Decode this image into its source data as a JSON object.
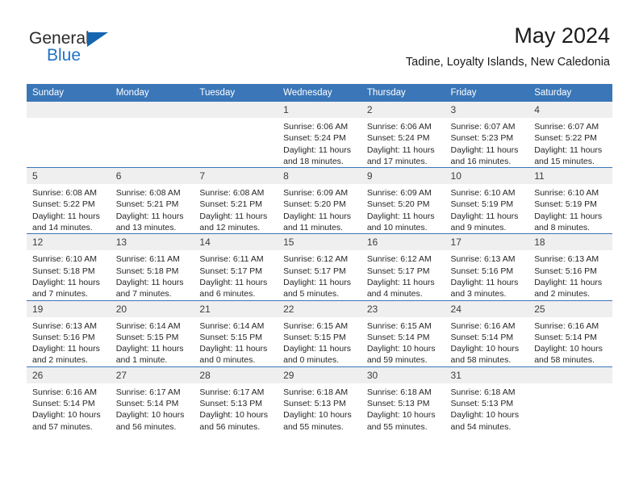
{
  "brand": {
    "name_part1": "General",
    "name_part2": "Blue",
    "accent_color": "#1f73c4",
    "triangle_color": "#1565b0",
    "logo_icon": "triangle-flag-icon"
  },
  "header": {
    "title": "May 2024",
    "subtitle": "Tadine, Loyalty Islands, New Caledonia"
  },
  "theme": {
    "header_bg": "#3a76b8",
    "daynum_bg": "#efefef",
    "cell_border": "#3a76b8"
  },
  "calendar": {
    "weekday_headers": [
      "Sunday",
      "Monday",
      "Tuesday",
      "Wednesday",
      "Thursday",
      "Friday",
      "Saturday"
    ],
    "weeks": [
      [
        {
          "day": "",
          "sunrise": "",
          "sunset": "",
          "daylight_line1": "",
          "daylight_line2": ""
        },
        {
          "day": "",
          "sunrise": "",
          "sunset": "",
          "daylight_line1": "",
          "daylight_line2": ""
        },
        {
          "day": "",
          "sunrise": "",
          "sunset": "",
          "daylight_line1": "",
          "daylight_line2": ""
        },
        {
          "day": "1",
          "sunrise": "Sunrise: 6:06 AM",
          "sunset": "Sunset: 5:24 PM",
          "daylight_line1": "Daylight: 11 hours",
          "daylight_line2": "and 18 minutes."
        },
        {
          "day": "2",
          "sunrise": "Sunrise: 6:06 AM",
          "sunset": "Sunset: 5:24 PM",
          "daylight_line1": "Daylight: 11 hours",
          "daylight_line2": "and 17 minutes."
        },
        {
          "day": "3",
          "sunrise": "Sunrise: 6:07 AM",
          "sunset": "Sunset: 5:23 PM",
          "daylight_line1": "Daylight: 11 hours",
          "daylight_line2": "and 16 minutes."
        },
        {
          "day": "4",
          "sunrise": "Sunrise: 6:07 AM",
          "sunset": "Sunset: 5:22 PM",
          "daylight_line1": "Daylight: 11 hours",
          "daylight_line2": "and 15 minutes."
        }
      ],
      [
        {
          "day": "5",
          "sunrise": "Sunrise: 6:08 AM",
          "sunset": "Sunset: 5:22 PM",
          "daylight_line1": "Daylight: 11 hours",
          "daylight_line2": "and 14 minutes."
        },
        {
          "day": "6",
          "sunrise": "Sunrise: 6:08 AM",
          "sunset": "Sunset: 5:21 PM",
          "daylight_line1": "Daylight: 11 hours",
          "daylight_line2": "and 13 minutes."
        },
        {
          "day": "7",
          "sunrise": "Sunrise: 6:08 AM",
          "sunset": "Sunset: 5:21 PM",
          "daylight_line1": "Daylight: 11 hours",
          "daylight_line2": "and 12 minutes."
        },
        {
          "day": "8",
          "sunrise": "Sunrise: 6:09 AM",
          "sunset": "Sunset: 5:20 PM",
          "daylight_line1": "Daylight: 11 hours",
          "daylight_line2": "and 11 minutes."
        },
        {
          "day": "9",
          "sunrise": "Sunrise: 6:09 AM",
          "sunset": "Sunset: 5:20 PM",
          "daylight_line1": "Daylight: 11 hours",
          "daylight_line2": "and 10 minutes."
        },
        {
          "day": "10",
          "sunrise": "Sunrise: 6:10 AM",
          "sunset": "Sunset: 5:19 PM",
          "daylight_line1": "Daylight: 11 hours",
          "daylight_line2": "and 9 minutes."
        },
        {
          "day": "11",
          "sunrise": "Sunrise: 6:10 AM",
          "sunset": "Sunset: 5:19 PM",
          "daylight_line1": "Daylight: 11 hours",
          "daylight_line2": "and 8 minutes."
        }
      ],
      [
        {
          "day": "12",
          "sunrise": "Sunrise: 6:10 AM",
          "sunset": "Sunset: 5:18 PM",
          "daylight_line1": "Daylight: 11 hours",
          "daylight_line2": "and 7 minutes."
        },
        {
          "day": "13",
          "sunrise": "Sunrise: 6:11 AM",
          "sunset": "Sunset: 5:18 PM",
          "daylight_line1": "Daylight: 11 hours",
          "daylight_line2": "and 7 minutes."
        },
        {
          "day": "14",
          "sunrise": "Sunrise: 6:11 AM",
          "sunset": "Sunset: 5:17 PM",
          "daylight_line1": "Daylight: 11 hours",
          "daylight_line2": "and 6 minutes."
        },
        {
          "day": "15",
          "sunrise": "Sunrise: 6:12 AM",
          "sunset": "Sunset: 5:17 PM",
          "daylight_line1": "Daylight: 11 hours",
          "daylight_line2": "and 5 minutes."
        },
        {
          "day": "16",
          "sunrise": "Sunrise: 6:12 AM",
          "sunset": "Sunset: 5:17 PM",
          "daylight_line1": "Daylight: 11 hours",
          "daylight_line2": "and 4 minutes."
        },
        {
          "day": "17",
          "sunrise": "Sunrise: 6:13 AM",
          "sunset": "Sunset: 5:16 PM",
          "daylight_line1": "Daylight: 11 hours",
          "daylight_line2": "and 3 minutes."
        },
        {
          "day": "18",
          "sunrise": "Sunrise: 6:13 AM",
          "sunset": "Sunset: 5:16 PM",
          "daylight_line1": "Daylight: 11 hours",
          "daylight_line2": "and 2 minutes."
        }
      ],
      [
        {
          "day": "19",
          "sunrise": "Sunrise: 6:13 AM",
          "sunset": "Sunset: 5:16 PM",
          "daylight_line1": "Daylight: 11 hours",
          "daylight_line2": "and 2 minutes."
        },
        {
          "day": "20",
          "sunrise": "Sunrise: 6:14 AM",
          "sunset": "Sunset: 5:15 PM",
          "daylight_line1": "Daylight: 11 hours",
          "daylight_line2": "and 1 minute."
        },
        {
          "day": "21",
          "sunrise": "Sunrise: 6:14 AM",
          "sunset": "Sunset: 5:15 PM",
          "daylight_line1": "Daylight: 11 hours",
          "daylight_line2": "and 0 minutes."
        },
        {
          "day": "22",
          "sunrise": "Sunrise: 6:15 AM",
          "sunset": "Sunset: 5:15 PM",
          "daylight_line1": "Daylight: 11 hours",
          "daylight_line2": "and 0 minutes."
        },
        {
          "day": "23",
          "sunrise": "Sunrise: 6:15 AM",
          "sunset": "Sunset: 5:14 PM",
          "daylight_line1": "Daylight: 10 hours",
          "daylight_line2": "and 59 minutes."
        },
        {
          "day": "24",
          "sunrise": "Sunrise: 6:16 AM",
          "sunset": "Sunset: 5:14 PM",
          "daylight_line1": "Daylight: 10 hours",
          "daylight_line2": "and 58 minutes."
        },
        {
          "day": "25",
          "sunrise": "Sunrise: 6:16 AM",
          "sunset": "Sunset: 5:14 PM",
          "daylight_line1": "Daylight: 10 hours",
          "daylight_line2": "and 58 minutes."
        }
      ],
      [
        {
          "day": "26",
          "sunrise": "Sunrise: 6:16 AM",
          "sunset": "Sunset: 5:14 PM",
          "daylight_line1": "Daylight: 10 hours",
          "daylight_line2": "and 57 minutes."
        },
        {
          "day": "27",
          "sunrise": "Sunrise: 6:17 AM",
          "sunset": "Sunset: 5:14 PM",
          "daylight_line1": "Daylight: 10 hours",
          "daylight_line2": "and 56 minutes."
        },
        {
          "day": "28",
          "sunrise": "Sunrise: 6:17 AM",
          "sunset": "Sunset: 5:13 PM",
          "daylight_line1": "Daylight: 10 hours",
          "daylight_line2": "and 56 minutes."
        },
        {
          "day": "29",
          "sunrise": "Sunrise: 6:18 AM",
          "sunset": "Sunset: 5:13 PM",
          "daylight_line1": "Daylight: 10 hours",
          "daylight_line2": "and 55 minutes."
        },
        {
          "day": "30",
          "sunrise": "Sunrise: 6:18 AM",
          "sunset": "Sunset: 5:13 PM",
          "daylight_line1": "Daylight: 10 hours",
          "daylight_line2": "and 55 minutes."
        },
        {
          "day": "31",
          "sunrise": "Sunrise: 6:18 AM",
          "sunset": "Sunset: 5:13 PM",
          "daylight_line1": "Daylight: 10 hours",
          "daylight_line2": "and 54 minutes."
        },
        {
          "day": "",
          "sunrise": "",
          "sunset": "",
          "daylight_line1": "",
          "daylight_line2": ""
        }
      ]
    ]
  }
}
